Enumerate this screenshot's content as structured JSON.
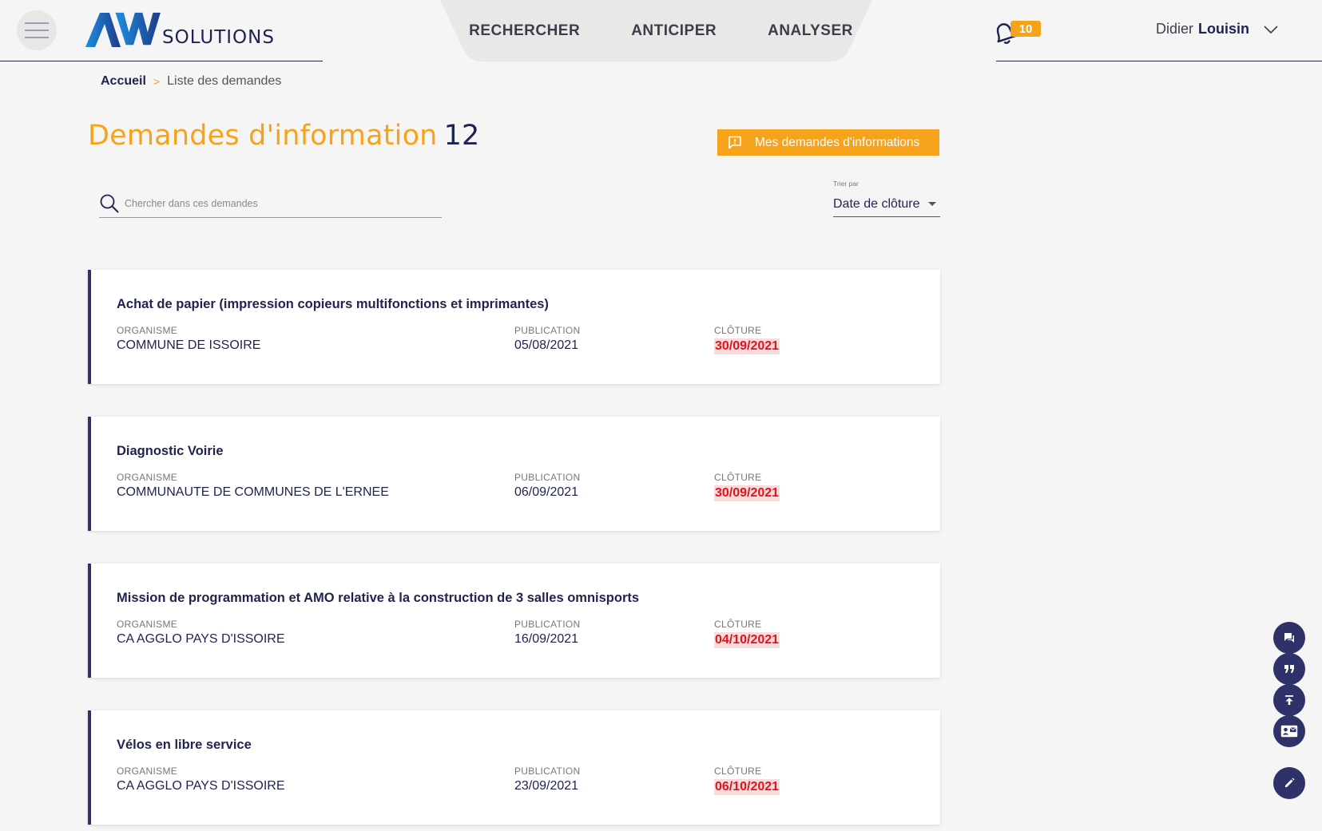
{
  "header": {
    "logo_text": "SOLUTIONS",
    "nav": [
      "RECHERCHER",
      "ANTICIPER",
      "ANALYSER"
    ],
    "notifications_count": "10",
    "user_first": "Didier",
    "user_last": "Louisin"
  },
  "breadcrumb": {
    "home": "Accueil",
    "separator": ">",
    "current": "Liste des demandes"
  },
  "page": {
    "title": "Demandes d'information",
    "count": "12",
    "my_requests_label": "Mes demandes d'informations"
  },
  "search": {
    "placeholder": "Chercher dans ces demandes"
  },
  "sort": {
    "label": "Trier par",
    "value": "Date de clôture"
  },
  "labels": {
    "organisme": "ORGANISME",
    "publication": "PUBLICATION",
    "cloture": "CLÔTURE"
  },
  "requests": [
    {
      "title": "Achat de papier (impression copieurs multifonctions et imprimantes)",
      "organisme": "COMMUNE DE ISSOIRE",
      "publication": "05/08/2021",
      "cloture": "30/09/2021"
    },
    {
      "title": "Diagnostic Voirie",
      "organisme": "COMMUNAUTE DE COMMUNES DE L'ERNEE",
      "publication": "06/09/2021",
      "cloture": "30/09/2021"
    },
    {
      "title": "Mission de programmation et AMO relative à la construction de 3 salles omnisports",
      "organisme": "CA AGGLO PAYS D'ISSOIRE",
      "publication": "16/09/2021",
      "cloture": "04/10/2021"
    },
    {
      "title": "Vélos en libre service",
      "organisme": "CA AGGLO PAYS D'ISSOIRE",
      "publication": "23/09/2021",
      "cloture": "06/10/2021"
    }
  ],
  "floating_icons": [
    "chat-icon",
    "quote-icon",
    "scroll-top-icon",
    "contact-card-icon",
    "edit-icon"
  ],
  "colors": {
    "accent": "#f6a31b",
    "navy": "#1e2350",
    "card_border": "#2e3268",
    "deadline_bg": "#fadada",
    "deadline_text": "#e0151c"
  }
}
